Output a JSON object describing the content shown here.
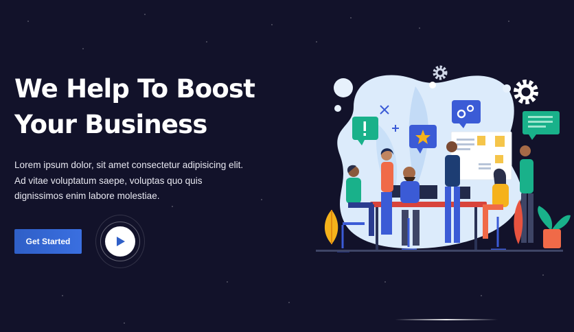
{
  "hero": {
    "title_line1": "We Help To Boost",
    "title_line2": "Your Business",
    "subtitle": "Lorem ipsum dolor, sit amet consectetur adipisicing elit. Ad vitae voluptatum saepe, voluptas quo quis dignissimos enim labore molestiae."
  },
  "actions": {
    "primary_label": "Get Started",
    "play_icon": "play-icon"
  },
  "colors": {
    "background": "#12122a",
    "accent": "#3a6fe0",
    "blob": "#dcebfb",
    "illustration_blue": "#3b5bd6"
  },
  "illustration": {
    "name": "team-meeting-illustration",
    "icons": [
      "gear-icon",
      "chat-bubble-icon",
      "star-icon",
      "exclamation-icon",
      "plant-icon"
    ]
  }
}
